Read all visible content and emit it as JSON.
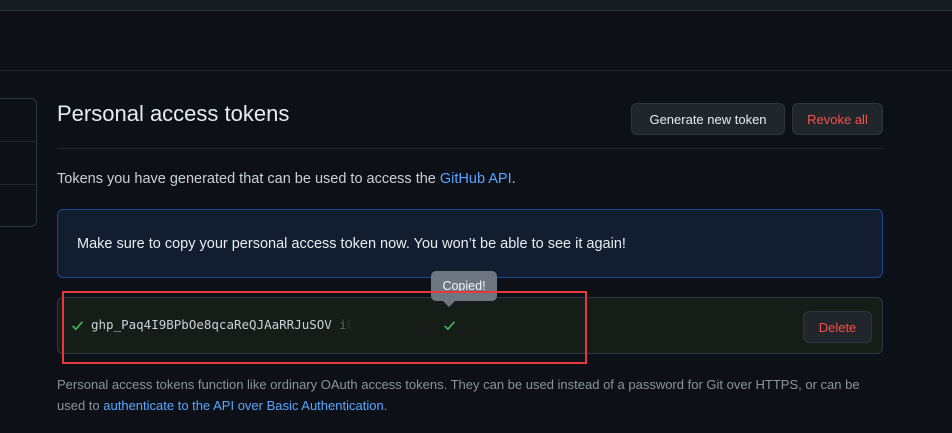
{
  "page": {
    "title": "Personal access tokens",
    "buttons": {
      "generate": "Generate new token",
      "revoke_all": "Revoke all"
    },
    "intro": {
      "text": "Tokens you have generated that can be used to access the ",
      "link": "GitHub API",
      "suffix": "."
    },
    "flash": {
      "message": "Make sure to copy your personal access token now. You won’t be able to see it again!"
    },
    "token": {
      "value": "ghp_Paq4I9BPbOe8qcaReQJAaRRJuSOV  i0> J",
      "tooltip": "Copied!",
      "delete_label": "Delete"
    },
    "footnote": {
      "text": "Personal access tokens function like ordinary OAuth access tokens. They can be used instead of a password for Git over HTTPS, or can be used to ",
      "link": "authenticate to the API over Basic Authentication",
      "suffix": "."
    }
  },
  "colors": {
    "background": "#0d1117",
    "accent_link": "#58a6ff",
    "danger": "#f85149",
    "success": "#3fb950",
    "annotation": "#e5393d"
  }
}
